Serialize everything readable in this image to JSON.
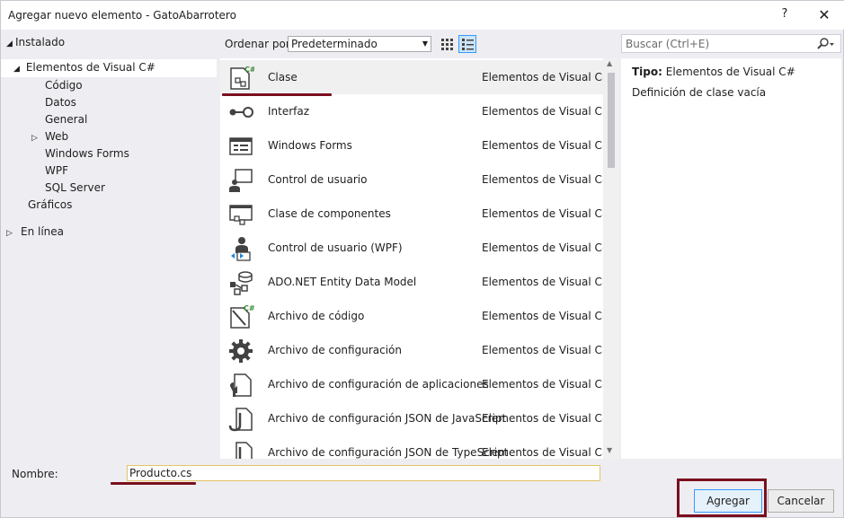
{
  "window": {
    "title": "Agregar nuevo elemento - GatoAbarrotero",
    "help_label": "?",
    "close_label": "✕"
  },
  "tree": {
    "installed": "Instalado",
    "visual_csharp": "Elementos de Visual C#",
    "children": [
      "Código",
      "Datos",
      "General",
      "Web",
      "Windows Forms",
      "WPF",
      "SQL Server"
    ],
    "graphics": "Gráficos",
    "online": "En línea"
  },
  "toolbar": {
    "sort_label": "Ordenar por:",
    "sort_value": "Predeterminado",
    "search_placeholder": "Buscar (Ctrl+E)"
  },
  "items": [
    {
      "name": "Clase",
      "category": "Elementos de Visual C#",
      "icon": "class-icon"
    },
    {
      "name": "Interfaz",
      "category": "Elementos de Visual C#",
      "icon": "interface-icon"
    },
    {
      "name": "Windows Forms",
      "category": "Elementos de Visual C#",
      "icon": "windows-form-icon"
    },
    {
      "name": "Control de usuario",
      "category": "Elementos de Visual C#",
      "icon": "user-control-icon"
    },
    {
      "name": "Clase de componentes",
      "category": "Elementos de Visual C#",
      "icon": "component-class-icon"
    },
    {
      "name": "Control de usuario (WPF)",
      "category": "Elementos de Visual C#",
      "icon": "wpf-user-control-icon"
    },
    {
      "name": "ADO.NET Entity Data Model",
      "category": "Elementos de Visual C#",
      "icon": "entity-model-icon"
    },
    {
      "name": "Archivo de código",
      "category": "Elementos de Visual C#",
      "icon": "code-file-icon"
    },
    {
      "name": "Archivo de configuración",
      "category": "Elementos de Visual C#",
      "icon": "gear-icon"
    },
    {
      "name": "Archivo de configuración de aplicaciones",
      "category": "Elementos de Visual C#",
      "icon": "app-config-icon"
    },
    {
      "name": "Archivo de configuración JSON de JavaScript",
      "category": "Elementos de Visual C#",
      "icon": "json-js-icon"
    },
    {
      "name": "Archivo de configuración JSON de TypeScript",
      "category": "Elementos de Visual C#",
      "icon": "json-ts-icon"
    }
  ],
  "details": {
    "type_label": "Tipo:",
    "type_value": "Elementos de Visual C#",
    "description": "Definición de clase vacía"
  },
  "footer": {
    "name_label": "Nombre:",
    "name_value": "Producto.cs",
    "add_label": "Agregar",
    "cancel_label": "Cancelar"
  },
  "colors": {
    "accent": "#3399ff",
    "annotation": "#7a0f1f",
    "csharp_green": "#388a34"
  }
}
